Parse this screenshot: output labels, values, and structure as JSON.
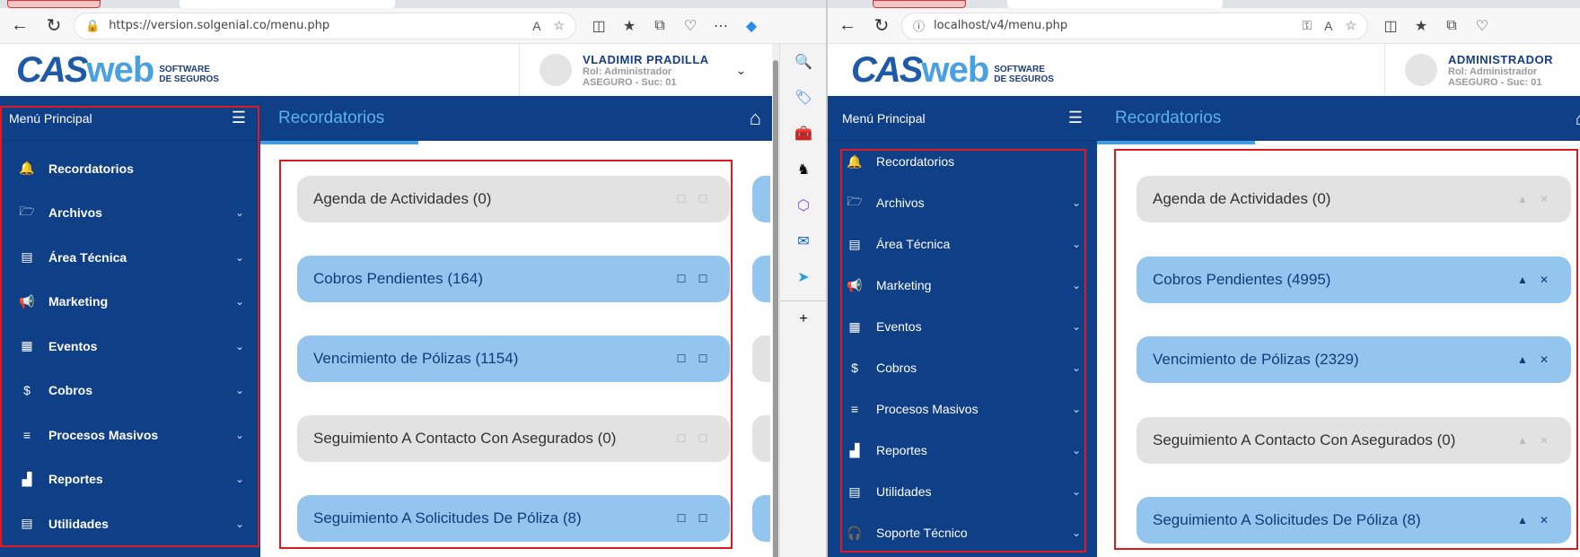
{
  "left": {
    "url": "https://version.solgenial.co/menu.php",
    "logo": {
      "mark": "CAS",
      "web": "web",
      "tag1": "SOFTWARE",
      "tag2": "DE SEGUROS"
    },
    "user": {
      "name": "VLADIMIR PRADILLA",
      "role": "Rol: Administrador",
      "branch": "ASEGURO - Suc: 01"
    },
    "sidebar": {
      "title": "Menú Principal",
      "items": [
        {
          "label": "Recordatorios",
          "icon": "bell-icon",
          "glyph": "🔔",
          "has_chevron": false
        },
        {
          "label": "Archivos",
          "icon": "folder-icon",
          "glyph": "🗁",
          "has_chevron": true
        },
        {
          "label": "Área Técnica",
          "icon": "document-icon",
          "glyph": "▤",
          "has_chevron": true
        },
        {
          "label": "Marketing",
          "icon": "megaphone-icon",
          "glyph": "📢",
          "has_chevron": true
        },
        {
          "label": "Eventos",
          "icon": "calendar-icon",
          "glyph": "▦",
          "has_chevron": true
        },
        {
          "label": "Cobros",
          "icon": "dollar-icon",
          "glyph": "$",
          "has_chevron": true
        },
        {
          "label": "Procesos Masivos",
          "icon": "list-edit-icon",
          "glyph": "≡",
          "has_chevron": true
        },
        {
          "label": "Reportes",
          "icon": "bar-chart-icon",
          "glyph": "▟",
          "has_chevron": true
        },
        {
          "label": "Utilidades",
          "icon": "table-icon",
          "glyph": "▤",
          "has_chevron": true
        }
      ]
    },
    "content": {
      "title": "Recordatorios",
      "cards": [
        {
          "text": "Agenda de Actividades (0)",
          "style": "gray"
        },
        {
          "text": "Cobros Pendientes (164)",
          "style": "blue"
        },
        {
          "text": "Vencimiento de Pólizas (1154)",
          "style": "blue"
        },
        {
          "text": "Seguimiento A Contacto Con Asegurados (0)",
          "style": "gray"
        },
        {
          "text": "Seguimiento A Solicitudes De Póliza (8)",
          "style": "blue"
        }
      ],
      "btn_a": "☐",
      "btn_b": "☐"
    }
  },
  "right": {
    "url": "localhost/v4/menu.php",
    "logo": {
      "mark": "CAS",
      "web": "web",
      "tag1": "SOFTWARE",
      "tag2": "DE SEGUROS"
    },
    "user": {
      "name": "ADMINISTRADOR",
      "role": "Rol: Administrador",
      "branch": "ASEGURO - Suc: 01"
    },
    "sidebar": {
      "title": "Menú Principal",
      "items": [
        {
          "label": "Recordatorios",
          "icon": "bell-icon",
          "glyph": "🔔",
          "has_chevron": false
        },
        {
          "label": "Archivos",
          "icon": "folder-icon",
          "glyph": "🗁",
          "has_chevron": true
        },
        {
          "label": "Área Técnica",
          "icon": "document-icon",
          "glyph": "▤",
          "has_chevron": true
        },
        {
          "label": "Marketing",
          "icon": "megaphone-icon",
          "glyph": "📢",
          "has_chevron": true
        },
        {
          "label": "Eventos",
          "icon": "calendar-icon",
          "glyph": "▦",
          "has_chevron": true
        },
        {
          "label": "Cobros",
          "icon": "dollar-icon",
          "glyph": "$",
          "has_chevron": true
        },
        {
          "label": "Procesos Masivos",
          "icon": "list-edit-icon",
          "glyph": "≡",
          "has_chevron": true
        },
        {
          "label": "Reportes",
          "icon": "bar-chart-icon",
          "glyph": "▟",
          "has_chevron": true
        },
        {
          "label": "Utilidades",
          "icon": "table-icon",
          "glyph": "▤",
          "has_chevron": true
        },
        {
          "label": "Soporte Técnico",
          "icon": "headset-icon",
          "glyph": "🎧",
          "has_chevron": true
        }
      ]
    },
    "content": {
      "title": "Recordatorios",
      "cards": [
        {
          "text": "Agenda de Actividades (0)",
          "style": "gray"
        },
        {
          "text": "Cobros Pendientes (4995)",
          "style": "blue"
        },
        {
          "text": "Vencimiento de Pólizas (2329)",
          "style": "blue"
        },
        {
          "text": "Seguimiento A Contacto Con Asegurados (0)",
          "style": "gray"
        },
        {
          "text": "Seguimiento A Solicitudes De Póliza (8)",
          "style": "blue"
        }
      ],
      "btn_a": "▲",
      "btn_b": "✕"
    }
  },
  "colors": {
    "sidebar_bg": "#0f3f86",
    "card_blue": "#93c5ee",
    "card_gray": "#e2e2e2",
    "highlight": "#e0191e"
  }
}
